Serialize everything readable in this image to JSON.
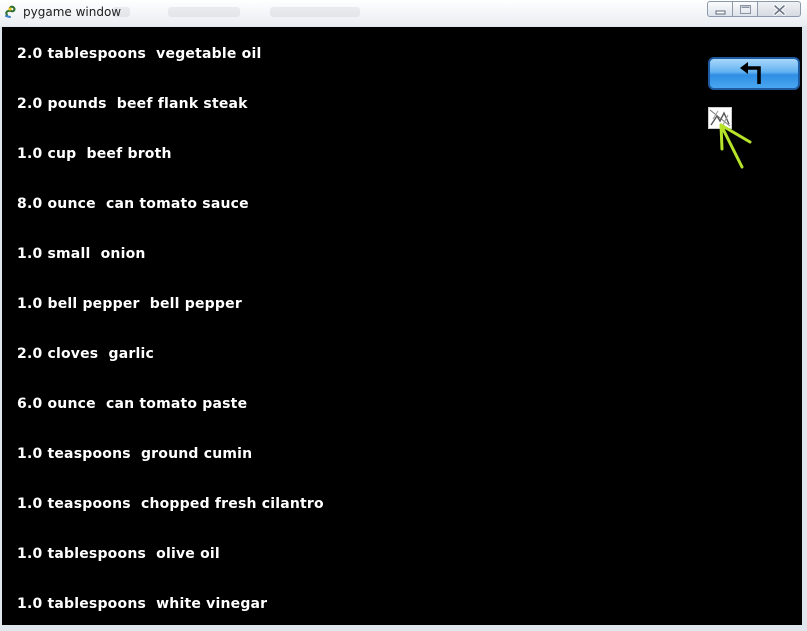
{
  "window": {
    "title": "pygame window",
    "controls": {
      "minimize_icon": "minimize-icon",
      "maximize_icon": "maximize-icon",
      "close_icon": "close-icon"
    }
  },
  "ingredients": [
    "2.0 tablespoons  vegetable oil",
    "2.0 pounds  beef flank steak",
    "1.0 cup  beef broth",
    "8.0 ounce  can tomato sauce",
    "1.0 small  onion",
    "1.0 bell pepper  bell pepper",
    "2.0 cloves  garlic",
    "6.0 ounce  can tomato paste",
    "1.0 teaspoons  ground cumin",
    "1.0 teaspoons  chopped fresh cilantro",
    "1.0 tablespoons  olive oil",
    "1.0 tablespoons  white vinegar"
  ],
  "back_button": {
    "icon": "return-arrow-icon"
  },
  "broken_image": {
    "icon": "broken-image-icon"
  },
  "colors": {
    "background": "#000000",
    "text": "#ffffff",
    "button_blue": "#3a95e8",
    "pointer_green": "#b6e32a"
  }
}
